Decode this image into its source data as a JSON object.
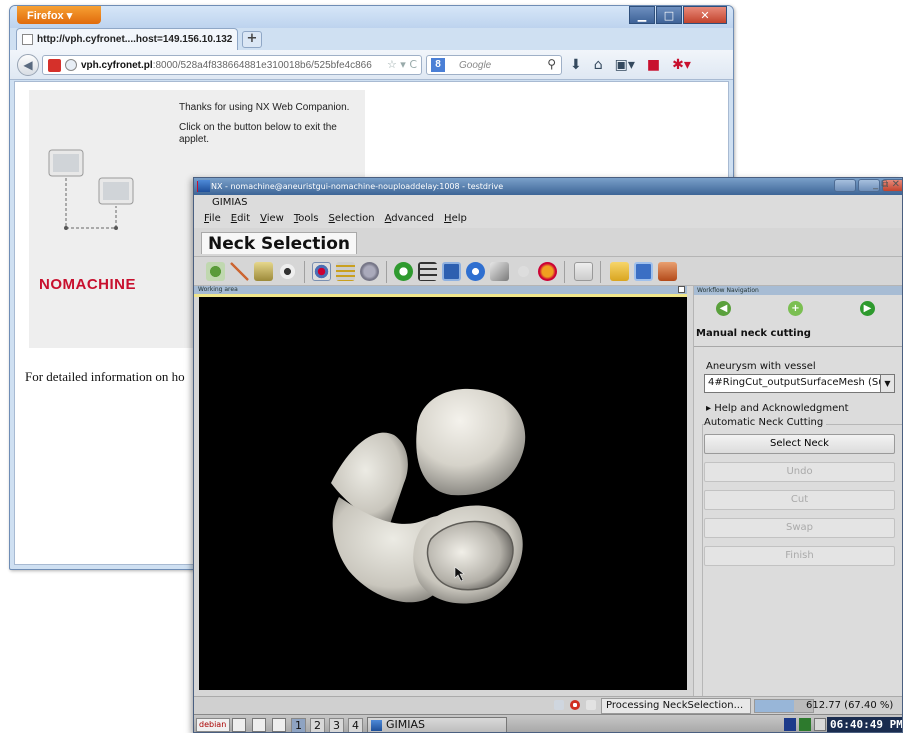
{
  "firefox": {
    "menu_button": "Firefox ▾",
    "window_controls": {
      "minimize": "▁",
      "maximize": "□",
      "close": "✕"
    },
    "tab_title": "http://vph.cyfronet....host=149.156.10.132",
    "new_tab": "+",
    "url_domain": "vph.cyfronet.pl",
    "url_rest": ":8000/528a4f838664881e310018b6/525bfe4c866",
    "search_engine": "Google",
    "page": {
      "thanks": "Thanks for using NX Web Companion.",
      "click_info": "Click on the button below to exit the applet.",
      "brand": "NOMACHINE",
      "detailed": "For detailed information on ho"
    }
  },
  "nx": {
    "window_title": "NX - nomachine@aneuristgui-nomachine-nouploaddelay:1008 - testdrive",
    "app_title": "GIMIAS",
    "menu": [
      "File",
      "Edit",
      "View",
      "Tools",
      "Selection",
      "Advanced",
      "Help"
    ],
    "perspective": "Neck Selection",
    "working_area": "Working area",
    "workflow": {
      "header": "Workflow Navigation",
      "title": "Manual neck cutting",
      "vessel_label": "Aneurysm with vessel",
      "vessel_value": "4#RingCut_outputSurfaceMesh (Su",
      "help_ack": "▸ Help and Acknowledgment",
      "auto_cut": "Automatic Neck Cutting",
      "buttons": {
        "select_neck": "Select Neck",
        "undo": "Undo",
        "cut": "Cut",
        "swap": "Swap",
        "finish": "Finish"
      }
    },
    "status": {
      "message": "Processing NeckSelection...",
      "value": "612.77  (67.40 %)",
      "progress": 0.674
    },
    "taskbar": {
      "start": "debian",
      "workspaces": [
        "1",
        "2",
        "3",
        "4"
      ],
      "active_workspace": "1",
      "task": "GIMIAS",
      "clock": "06:40:49 PM"
    }
  }
}
